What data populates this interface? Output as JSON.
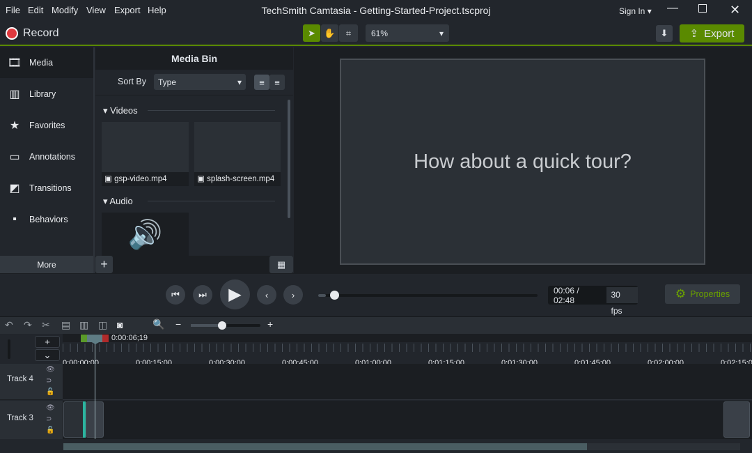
{
  "menu": [
    "File",
    "Edit",
    "Modify",
    "View",
    "Export",
    "Help"
  ],
  "window_title": "TechSmith Camtasia - Getting-Started-Project.tscproj",
  "sign_in": "Sign In",
  "record_label": "Record",
  "zoom_value": "61%",
  "export_label": "Export",
  "sidebar": {
    "items": [
      {
        "label": "Media",
        "icon": "film-icon"
      },
      {
        "label": "Library",
        "icon": "books-icon"
      },
      {
        "label": "Favorites",
        "icon": "star-icon"
      },
      {
        "label": "Annotations",
        "icon": "annotation-icon"
      },
      {
        "label": "Transitions",
        "icon": "transition-icon"
      },
      {
        "label": "Behaviors",
        "icon": "behaviors-icon"
      }
    ],
    "more": "More"
  },
  "bin": {
    "title": "Media Bin",
    "sort_by": "Sort By",
    "sort_value": "Type",
    "sections": {
      "videos": "Videos",
      "audio": "Audio"
    },
    "videos": [
      "gsp-video.mp4",
      "splash-screen.mp4"
    ]
  },
  "preview": {
    "text": "How about a quick tour?"
  },
  "playback": {
    "time": "00:06 / 02:48",
    "fps": "30 fps",
    "properties": "Properties",
    "progress_fraction": 0.036
  },
  "timeline": {
    "playhead": "0:00:06;19",
    "ticks": [
      "0:00:00;00",
      "0:00:15;00",
      "0:00:30;00",
      "0:00:45;00",
      "0:01:00;00",
      "0:01:15;00",
      "0:01:30;00",
      "0:01:45;00",
      "0:02:00;00",
      "0:02:15;0"
    ],
    "tracks": [
      "Track 4",
      "Track 3"
    ],
    "zoom_fraction": 0.45
  },
  "colors": {
    "accent": "#5a8a00",
    "record": "#e0393e",
    "clip": "#2bb5a0"
  }
}
